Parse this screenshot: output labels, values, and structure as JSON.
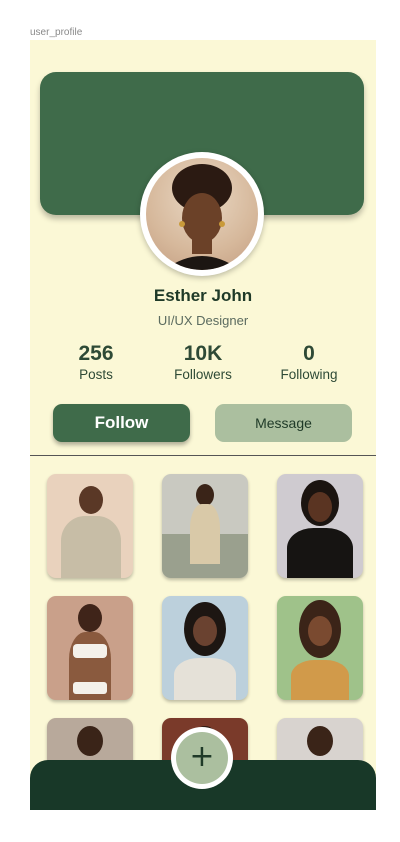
{
  "frame_label": "user_profile",
  "profile": {
    "name": "Esther John",
    "role": "UI/UX Designer"
  },
  "stats": [
    {
      "value": "256",
      "label": "Posts"
    },
    {
      "value": "10K",
      "label": "Followers"
    },
    {
      "value": "0",
      "label": "Following"
    }
  ],
  "actions": {
    "follow_label": "Follow",
    "message_label": "Message"
  },
  "fab": {
    "icon": "plus-icon",
    "glyph": "+"
  },
  "colors": {
    "background": "#fbf8d6",
    "primary_green": "#3f6b4a",
    "light_green": "#abbf9f",
    "dark_green": "#183828"
  },
  "photos": [
    "post-photo-1",
    "post-photo-2",
    "post-photo-3",
    "post-photo-4",
    "post-photo-5",
    "post-photo-6",
    "post-photo-7",
    "post-photo-8",
    "post-photo-9"
  ]
}
